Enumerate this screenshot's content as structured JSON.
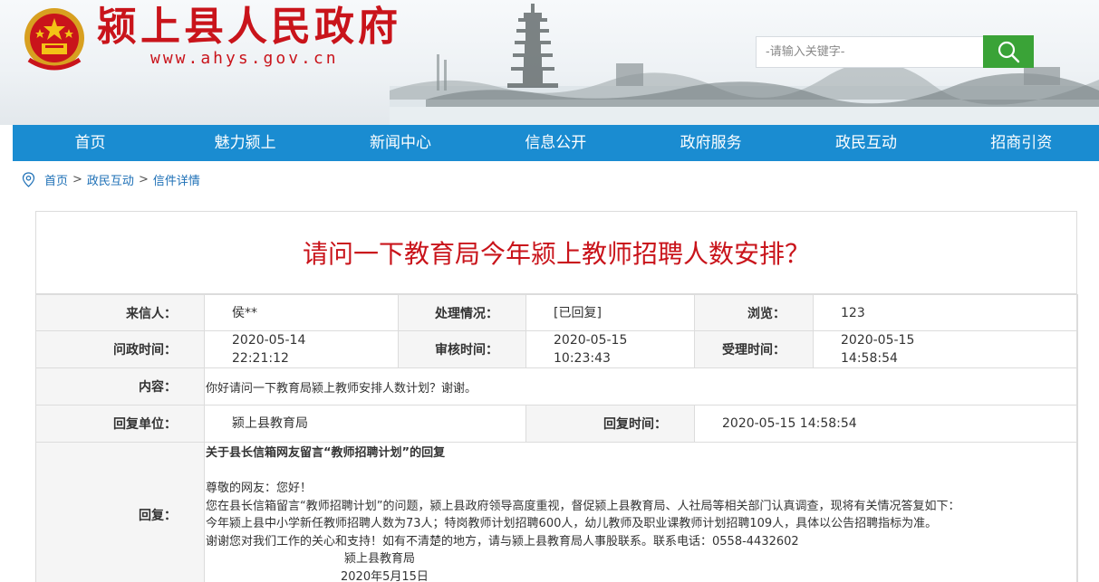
{
  "header": {
    "site_title": "颍上县人民政府",
    "site_url": "www.ahys.gov.cn",
    "search_placeholder": "-请输入关键字-"
  },
  "nav": [
    "首页",
    "魅力颍上",
    "新闻中心",
    "信息公开",
    "政府服务",
    "政民互动",
    "招商引资"
  ],
  "breadcrumb": {
    "items": [
      "首页",
      "政民互动",
      "信件详情"
    ],
    "separator": ">"
  },
  "letter": {
    "title": "请问一下教育局今年颍上教师招聘人数安排？",
    "sender_label": "来信人：",
    "sender": "侯**",
    "status_label": "处理情况：",
    "status": "[已回复]",
    "views_label": "浏览：",
    "views": "123",
    "ask_time_label": "问政时间：",
    "ask_date": "2020-05-14",
    "ask_time": "22:21:12",
    "review_time_label": "审核时间：",
    "review_date": "2020-05-15",
    "review_time": "10:23:43",
    "accept_time_label": "受理时间：",
    "accept_date": "2020-05-15",
    "accept_time": "14:58:54",
    "content_label": "内容：",
    "content": "你好请问一下教育局颍上教师安排人数计划？谢谢。",
    "reply_unit_label": "回复单位：",
    "reply_unit": "颍上县教育局",
    "reply_time_label": "回复时间：",
    "reply_time": "2020-05-15 14:58:54",
    "reply_label": "回复：",
    "reply": {
      "title": "关于县长信箱网友留言“教师招聘计划”的回复",
      "greeting": "尊敬的网友：您好！",
      "p1": "您在县长信箱留言“教师招聘计划”的问题，颍上县政府领导高度重视，督促颍上县教育局、人社局等相关部门认真调查，现将有关情况答复如下：",
      "p2": "今年颍上县中小学新任教师招聘人数为73人；特岗教师计划招聘600人，幼儿教师及职业课教师计划招聘109人，具体以公告招聘指标为准。",
      "p3": "谢谢您对我们工作的关心和支持！如有不清楚的地方，请与颍上县教育局人事股联系。联系电话：0558-4432602",
      "sign": "颍上县教育局",
      "date": "2020年5月15日"
    }
  },
  "colors": {
    "brand_red": "#c9141b",
    "nav_blue": "#1a8cd1",
    "search_green": "#3aa337",
    "link_blue": "#1c6fb6"
  },
  "icons": [
    "national-emblem-icon",
    "search-icon",
    "location-pin-icon"
  ]
}
